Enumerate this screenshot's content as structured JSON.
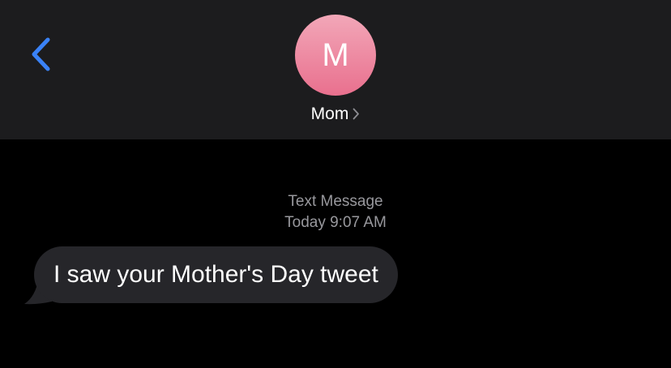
{
  "nav": {
    "accent_color": "#3a82f7",
    "back_icon": "chevron-left-icon"
  },
  "contact": {
    "initial": "M",
    "name": "Mom",
    "avatar_colors": [
      "#f2a7b8",
      "#e9708e"
    ],
    "detail_icon": "chevron-right-icon"
  },
  "thread": {
    "service": "Text Message",
    "timestamp": "Today 9:07 AM"
  },
  "messages": [
    {
      "direction": "incoming",
      "text": "I saw your Mother's Day tweet",
      "bubble_color": "#26262a"
    }
  ]
}
